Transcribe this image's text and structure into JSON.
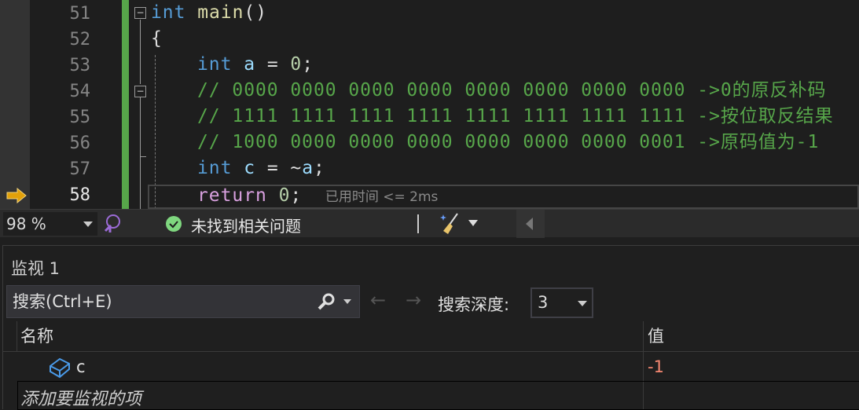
{
  "editor": {
    "line_numbers": [
      "51",
      "52",
      "53",
      "54",
      "55",
      "56",
      "57",
      "58"
    ],
    "lines": [
      [
        "int",
        " main",
        "()"
      ],
      [
        "{"
      ],
      [
        "int",
        " a",
        " = ",
        "0",
        ";"
      ],
      [
        "// 0000 0000 0000 0000 0000 0000 0000 0000 ->0的原反补码"
      ],
      [
        "// 1111 1111 1111 1111 1111 1111 1111 1111 ->按位取反结果"
      ],
      [
        "// 1000 0000 0000 0000 0000 0000 0000 0001 ->原码值为-1"
      ],
      [
        "int",
        " c",
        " = ~",
        "a",
        ";"
      ],
      [
        "return",
        " ",
        "0",
        ";"
      ]
    ],
    "elapsed": "已用时间 <= 2ms",
    "current_line": "58"
  },
  "status_bar": {
    "zoom": "98 %",
    "issues": "未找到相关问题"
  },
  "watch": {
    "title": "监视 1",
    "search_placeholder": "搜索(Ctrl+E)",
    "depth_label": "搜索深度:",
    "depth_value": "3",
    "columns": {
      "name": "名称",
      "value": "值"
    },
    "rows": [
      {
        "name": "c",
        "value": "-1"
      }
    ],
    "add_item": "添加要监视的项"
  },
  "colors": {
    "accent_green": "#57a64a",
    "value_changed": "#f48771",
    "keyword": "#569cd6"
  }
}
